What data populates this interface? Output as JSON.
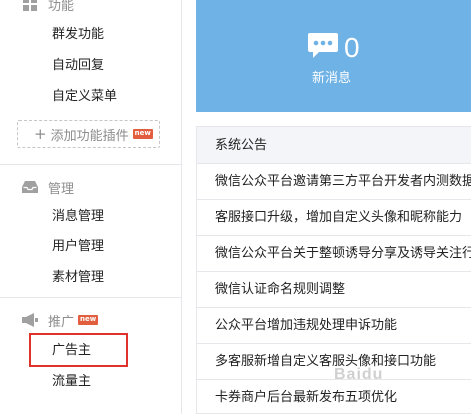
{
  "sidebar": {
    "function_section": {
      "title": "功能",
      "icon": "grid-icon"
    },
    "function_items": [
      "群发功能",
      "自动回复",
      "自定义菜单"
    ],
    "add_plugin": {
      "label": "添加功能插件",
      "badge": "new"
    },
    "manage_section": {
      "title": "管理",
      "icon": "inbox-icon"
    },
    "manage_items": [
      "消息管理",
      "用户管理",
      "素材管理"
    ],
    "promote_section": {
      "title": "推广",
      "icon": "megaphone-icon",
      "badge": "new"
    },
    "promote_items": [
      "广告主",
      "流量主"
    ]
  },
  "stats": {
    "new_messages": "0",
    "label": "新消息",
    "icon": "chat-bubble-icon"
  },
  "notices": {
    "title": "系统公告",
    "items": [
      "微信公众平台邀请第三方平台开发者内测数据",
      "客服接口升级，增加自定义头像和昵称能力",
      "微信公众平台关于整顿诱导分享及诱导关注行",
      "微信认证命名规则调整",
      "公众平台增加违规处理申诉功能",
      "多客服新增自定义客服头像和接口功能",
      "卡券商户后台最新发布五项优化"
    ]
  },
  "watermark": "Baidu",
  "colors": {
    "stat_bg": "#6fb2e6",
    "highlight": "#e0322c",
    "badge": "#e15f3f"
  }
}
